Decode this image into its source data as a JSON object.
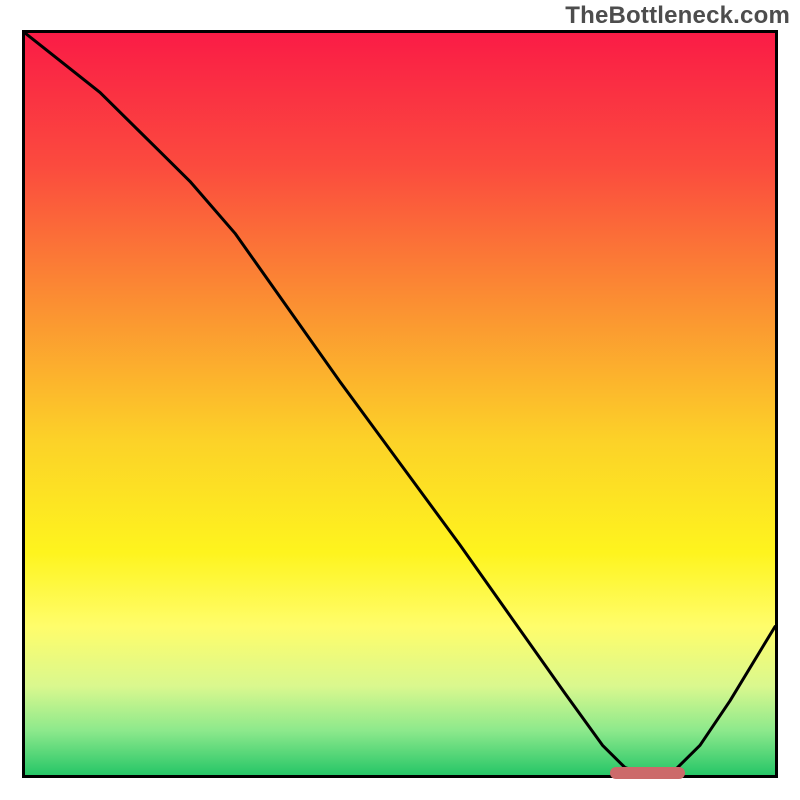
{
  "watermark": "TheBottleneck.com",
  "chart_data": {
    "type": "line",
    "title": "",
    "xlabel": "",
    "ylabel": "",
    "xlim": [
      0,
      100
    ],
    "ylim": [
      0,
      100
    ],
    "grid": false,
    "legend": false,
    "background_gradient": {
      "stops": [
        {
          "offset": 0.0,
          "color": "#fa1c46"
        },
        {
          "offset": 0.18,
          "color": "#fb4b3e"
        },
        {
          "offset": 0.35,
          "color": "#fb8a33"
        },
        {
          "offset": 0.55,
          "color": "#fcd228"
        },
        {
          "offset": 0.7,
          "color": "#fef41e"
        },
        {
          "offset": 0.8,
          "color": "#fffd6b"
        },
        {
          "offset": 0.88,
          "color": "#daf88e"
        },
        {
          "offset": 0.94,
          "color": "#8de98c"
        },
        {
          "offset": 1.0,
          "color": "#26c667"
        }
      ]
    },
    "series": [
      {
        "name": "bottleneck-curve",
        "color": "#000000",
        "stroke_width": 3,
        "x": [
          0,
          5,
          10,
          15,
          18,
          22,
          28,
          35,
          42,
          50,
          58,
          65,
          72,
          77,
          80,
          83,
          86,
          90,
          94,
          100
        ],
        "y": [
          100,
          96,
          92,
          87,
          84,
          80,
          73,
          63,
          53,
          42,
          31,
          21,
          11,
          4,
          1,
          0,
          0,
          4,
          10,
          20
        ]
      }
    ],
    "marker": {
      "name": "selected-range",
      "x_start": 78,
      "x_end": 88,
      "y": 0,
      "color": "#cc6a6a"
    }
  }
}
